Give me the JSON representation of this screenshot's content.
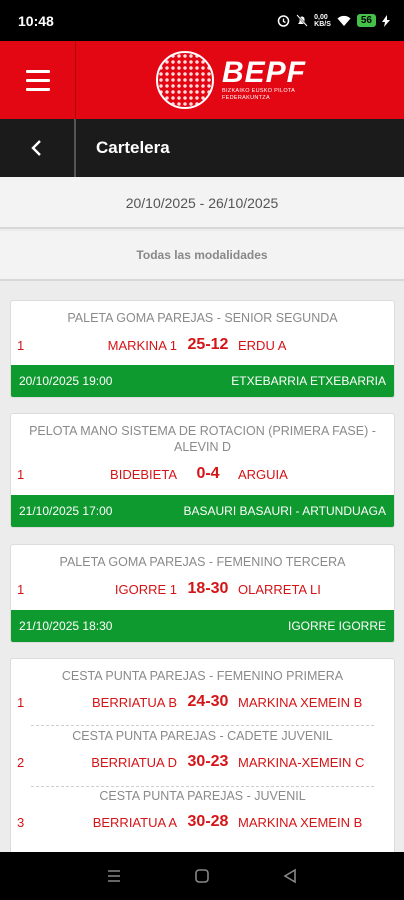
{
  "status": {
    "time": "10:48",
    "data_rate": "0,00\nKB/S",
    "battery": "56"
  },
  "header": {
    "brand": "BEPF",
    "brand_sub_1": "BIZKAIKO EUSKO PILOTA",
    "brand_sub_2": "FEDERAKUNTZA"
  },
  "page": {
    "title": "Cartelera",
    "date_range": "20/10/2025 - 26/10/2025",
    "filter": "Todas las modalidades"
  },
  "matches": [
    {
      "title": "PALETA GOMA PAREJAS - SENIOR SEGUNDA",
      "games": [
        {
          "num": "1",
          "home": "MARKINA 1",
          "score": "25-12",
          "away": "ERDU A"
        }
      ],
      "datetime": "20/10/2025 19:00",
      "place": "ETXEBARRIA ETXEBARRIA"
    },
    {
      "title": "PELOTA MANO SISTEMA DE ROTACION (PRIMERA FASE) - ALEVIN D",
      "games": [
        {
          "num": "1",
          "home": "BIDEBIETA",
          "score": "0-4",
          "away": "ARGUIA"
        }
      ],
      "datetime": "21/10/2025 17:00",
      "place": "BASAURI BASAURI - ARTUNDUAGA"
    },
    {
      "title": "PALETA GOMA PAREJAS - FEMENINO TERCERA",
      "games": [
        {
          "num": "1",
          "home": "IGORRE 1",
          "score": "18-30",
          "away": "OLARRETA LI"
        }
      ],
      "datetime": "21/10/2025 18:30",
      "place": "IGORRE IGORRE"
    },
    {
      "games_multi": [
        {
          "title": "CESTA PUNTA PAREJAS - FEMENINO PRIMERA",
          "num": "1",
          "home": "BERRIATUA B",
          "score": "24-30",
          "away": "MARKINA XEMEIN B"
        },
        {
          "title": "CESTA PUNTA PAREJAS - CADETE JUVENIL",
          "num": "2",
          "home": "BERRIATUA D",
          "score": "30-23",
          "away": "MARKINA-XEMEIN C"
        },
        {
          "title": "CESTA PUNTA PAREJAS - JUVENIL",
          "num": "3",
          "home": "BERRIATUA A",
          "score": "30-28",
          "away": "MARKINA XEMEIN B"
        }
      ]
    }
  ],
  "icons": {
    "menu": "hamburger-icon",
    "back": "chevron-left-icon",
    "alarm": "alarm-icon",
    "mute": "bell-off-icon",
    "wifi": "wifi-icon",
    "battery": "battery-icon",
    "bolt": "charging-icon",
    "nav_recent": "recent-apps-icon",
    "nav_home": "home-icon",
    "nav_back": "back-icon"
  },
  "colors": {
    "brand_red": "#e30613",
    "score_red": "#d41417",
    "venue_green": "#0f9a2f"
  }
}
